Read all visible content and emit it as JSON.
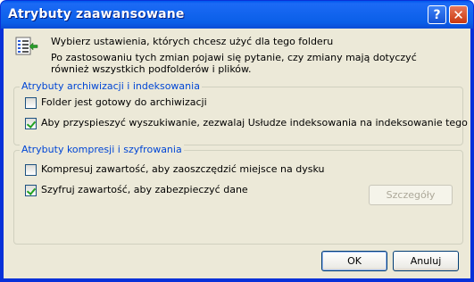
{
  "window": {
    "title": "Atrybuty zaawansowane",
    "help_symbol": "?",
    "close_symbol": "✕"
  },
  "intro": {
    "line1": "Wybierz ustawienia, których chcesz użyć dla tego folderu",
    "line2": "Po zastosowaniu tych zmian pojawi się pytanie, czy zmiany mają dotyczyć również wszystkich podfolderów i plików."
  },
  "archive_group": {
    "legend": "Atrybuty archiwizacji i indeksowania",
    "items": [
      {
        "label": "Folder jest gotowy do archiwizacji",
        "checked": false
      },
      {
        "label": "Aby przyspieszyć wyszukiwanie, zezwalaj Usłudze indeksowania na indeksowanie tego folderu",
        "checked": true
      }
    ]
  },
  "compress_group": {
    "legend": "Atrybuty kompresji i szyfrowania",
    "items": [
      {
        "label": "Kompresuj zawartość, aby zaoszczędzić miejsce na dysku",
        "checked": false
      },
      {
        "label": "Szyfruj zawartość, aby zabezpieczyć dane",
        "checked": true
      }
    ],
    "details_button": "Szczegóły"
  },
  "buttons": {
    "ok": "OK",
    "cancel": "Anuluj"
  }
}
